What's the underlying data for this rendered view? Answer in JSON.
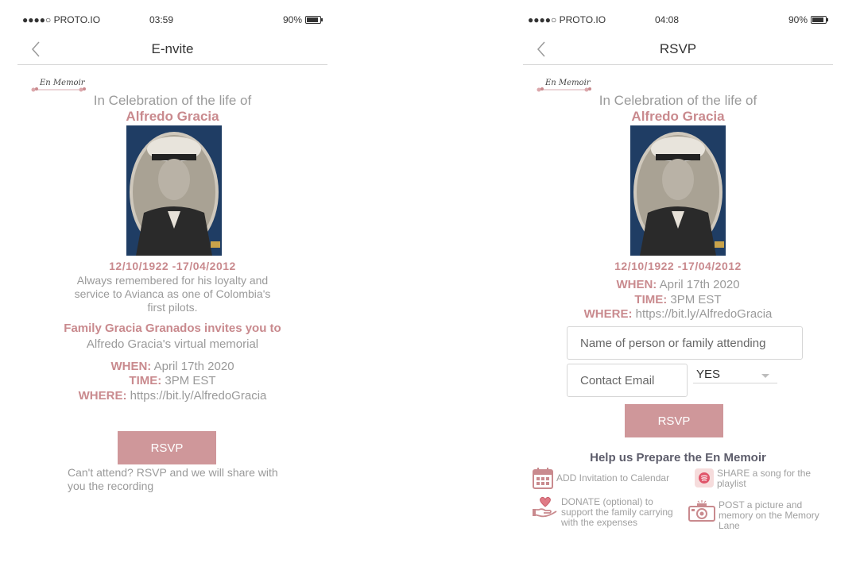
{
  "status": {
    "left_time": "03:59",
    "right_time": "04:08",
    "carrier": "●●●●○ PROTO.IO",
    "battery": "90%",
    "battery_level": 0.9
  },
  "left": {
    "nav_title": "E-nvite",
    "celebrate": "In Celebration of the life of",
    "name": "Alfredo Gracia",
    "dates": "12/10/1922 -17/04/2012",
    "memo_lines": [
      "Always remembered for his loyalty and",
      "service to Avianca as one of Colombia's",
      "first pilots."
    ],
    "invite": "Family Gracia Granados invites you to",
    "invite_sub": "Alfredo Gracia's virtual memorial",
    "when_label": "WHEN:",
    "when_value": "April 17th 2020",
    "time_label": "TIME:",
    "time_value": "3PM EST",
    "where_label": "WHERE:",
    "where_value": "https://bit.ly/AlfredoGracia",
    "rsvp_button": "RSVP",
    "cant_attend": "Can't attend? RSVP and we will share with you the recording"
  },
  "right": {
    "nav_title": "RSVP",
    "celebrate": "In Celebration of the life of",
    "name": "Alfredo Gracia",
    "dates": "12/10/1922 -17/04/2012",
    "when_label": "WHEN:",
    "when_value": "April 17th 2020",
    "time_label": "TIME:",
    "time_value": "3PM EST",
    "where_label": "WHERE:",
    "where_value": "https://bit.ly/AlfredoGracia",
    "name_placeholder": "Name of person or family attending",
    "email_placeholder": "Contact Email",
    "attend_value": "YES",
    "rsvp_button": "RSVP",
    "help_title": "Help us Prepare the En Memoir",
    "actions": {
      "calendar": "ADD Invitation to Calendar",
      "song": "SHARE a song for the playlist",
      "donate": "DONATE (optional) to support the family carrying with the expenses",
      "post": "POST a picture and memory on the Memory Lane"
    }
  },
  "logo_text": "En Memoir",
  "colors": {
    "accent": "#cf979a",
    "accent_text": "#c98a8e",
    "muted_text": "#9a9a9a",
    "divider": "#d4d4d4"
  },
  "icons": [
    "back-chevron-icon",
    "battery-icon",
    "calendar-icon",
    "music-icon",
    "donate-heart-hand-icon",
    "camera-icon",
    "memoir-logo"
  ]
}
